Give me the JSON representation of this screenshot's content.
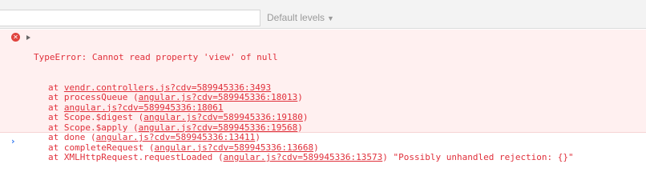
{
  "toolbar": {
    "filter_placeholder": "",
    "levels_label": "Default levels",
    "levels_caret": "▼"
  },
  "error": {
    "icon": "error-circle-icon",
    "first_line": "TypeError: Cannot read property 'view' of null",
    "frames": [
      {
        "at": "at ",
        "fn": "",
        "open": "",
        "link": "vendr.controllers.js?cdv=589945336:3493",
        "close": "",
        "suffix": ""
      },
      {
        "at": "at ",
        "fn": "processQueue ",
        "open": "(",
        "link": "angular.js?cdv=589945336:18013",
        "close": ")",
        "suffix": ""
      },
      {
        "at": "at ",
        "fn": "",
        "open": "",
        "link": "angular.js?cdv=589945336:18061",
        "close": "",
        "suffix": ""
      },
      {
        "at": "at ",
        "fn": "Scope.$digest ",
        "open": "(",
        "link": "angular.js?cdv=589945336:19180",
        "close": ")",
        "suffix": ""
      },
      {
        "at": "at ",
        "fn": "Scope.$apply ",
        "open": "(",
        "link": "angular.js?cdv=589945336:19568",
        "close": ")",
        "suffix": ""
      },
      {
        "at": "at ",
        "fn": "done ",
        "open": "(",
        "link": "angular.js?cdv=589945336:13411",
        "close": ")",
        "suffix": ""
      },
      {
        "at": "at ",
        "fn": "completeRequest ",
        "open": "(",
        "link": "angular.js?cdv=589945336:13668",
        "close": ")",
        "suffix": ""
      },
      {
        "at": "at ",
        "fn": "XMLHttpRequest.requestLoaded ",
        "open": "(",
        "link": "angular.js?cdv=589945336:13573",
        "close": ")",
        "suffix": " \"Possibly unhandled rejection: {}\""
      }
    ]
  },
  "prompt": {
    "chevron": "›"
  },
  "colors": {
    "error_text": "#e0303b",
    "error_bg": "#fff0f0",
    "prompt_accent": "#367cf1"
  }
}
